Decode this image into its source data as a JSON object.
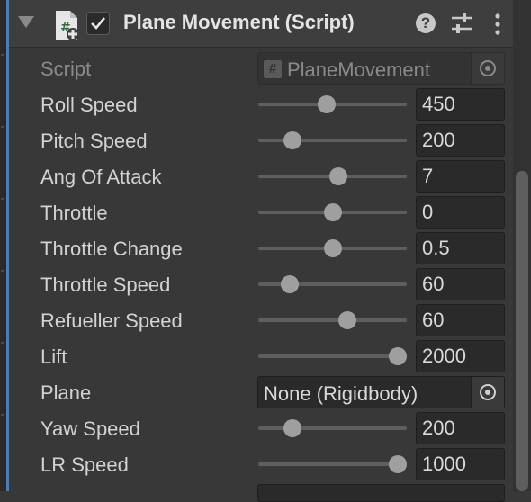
{
  "component": {
    "title": "Plane Movement (Script)",
    "enabled": true,
    "icons": {
      "foldout": "foldout-arrow-icon",
      "script": "csharp-script-icon",
      "help": "help-icon",
      "presets": "presets-icon",
      "menu": "kebab-menu-icon"
    }
  },
  "script_field": {
    "label": "Script",
    "value": "PlaneMovement",
    "icon": "#"
  },
  "sliders": [
    {
      "label": "Roll Speed",
      "value": "450",
      "level": 0.46
    },
    {
      "label": "Pitch Speed",
      "value": "200",
      "level": 0.23
    },
    {
      "label": "Ang Of Attack",
      "value": "7",
      "level": 0.54
    },
    {
      "label": "Throttle",
      "value": "0",
      "level": 0.5
    },
    {
      "label": "Throttle Change",
      "value": "0.5",
      "level": 0.5
    },
    {
      "label": "Throttle Speed",
      "value": "60",
      "level": 0.21
    },
    {
      "label": "Refueller Speed",
      "value": "60",
      "level": 0.6
    },
    {
      "label": "Lift",
      "value": "2000",
      "level": 0.94
    }
  ],
  "plane_field": {
    "label": "Plane",
    "value": "None (Rigidbody)"
  },
  "sliders2": [
    {
      "label": "Yaw Speed",
      "value": "200",
      "level": 0.23
    },
    {
      "label": "LR Speed",
      "value": "1000",
      "level": 0.94
    }
  ]
}
